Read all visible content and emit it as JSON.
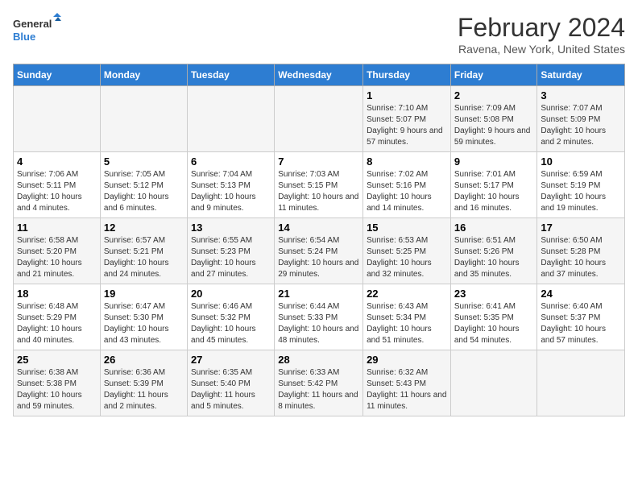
{
  "logo": {
    "line1": "General",
    "line2": "Blue"
  },
  "title": "February 2024",
  "subtitle": "Ravena, New York, United States",
  "days_of_week": [
    "Sunday",
    "Monday",
    "Tuesday",
    "Wednesday",
    "Thursday",
    "Friday",
    "Saturday"
  ],
  "weeks": [
    [
      {
        "day": "",
        "sunrise": "",
        "sunset": "",
        "daylight": ""
      },
      {
        "day": "",
        "sunrise": "",
        "sunset": "",
        "daylight": ""
      },
      {
        "day": "",
        "sunrise": "",
        "sunset": "",
        "daylight": ""
      },
      {
        "day": "",
        "sunrise": "",
        "sunset": "",
        "daylight": ""
      },
      {
        "day": "1",
        "sunrise": "Sunrise: 7:10 AM",
        "sunset": "Sunset: 5:07 PM",
        "daylight": "Daylight: 9 hours and 57 minutes."
      },
      {
        "day": "2",
        "sunrise": "Sunrise: 7:09 AM",
        "sunset": "Sunset: 5:08 PM",
        "daylight": "Daylight: 9 hours and 59 minutes."
      },
      {
        "day": "3",
        "sunrise": "Sunrise: 7:07 AM",
        "sunset": "Sunset: 5:09 PM",
        "daylight": "Daylight: 10 hours and 2 minutes."
      }
    ],
    [
      {
        "day": "4",
        "sunrise": "Sunrise: 7:06 AM",
        "sunset": "Sunset: 5:11 PM",
        "daylight": "Daylight: 10 hours and 4 minutes."
      },
      {
        "day": "5",
        "sunrise": "Sunrise: 7:05 AM",
        "sunset": "Sunset: 5:12 PM",
        "daylight": "Daylight: 10 hours and 6 minutes."
      },
      {
        "day": "6",
        "sunrise": "Sunrise: 7:04 AM",
        "sunset": "Sunset: 5:13 PM",
        "daylight": "Daylight: 10 hours and 9 minutes."
      },
      {
        "day": "7",
        "sunrise": "Sunrise: 7:03 AM",
        "sunset": "Sunset: 5:15 PM",
        "daylight": "Daylight: 10 hours and 11 minutes."
      },
      {
        "day": "8",
        "sunrise": "Sunrise: 7:02 AM",
        "sunset": "Sunset: 5:16 PM",
        "daylight": "Daylight: 10 hours and 14 minutes."
      },
      {
        "day": "9",
        "sunrise": "Sunrise: 7:01 AM",
        "sunset": "Sunset: 5:17 PM",
        "daylight": "Daylight: 10 hours and 16 minutes."
      },
      {
        "day": "10",
        "sunrise": "Sunrise: 6:59 AM",
        "sunset": "Sunset: 5:19 PM",
        "daylight": "Daylight: 10 hours and 19 minutes."
      }
    ],
    [
      {
        "day": "11",
        "sunrise": "Sunrise: 6:58 AM",
        "sunset": "Sunset: 5:20 PM",
        "daylight": "Daylight: 10 hours and 21 minutes."
      },
      {
        "day": "12",
        "sunrise": "Sunrise: 6:57 AM",
        "sunset": "Sunset: 5:21 PM",
        "daylight": "Daylight: 10 hours and 24 minutes."
      },
      {
        "day": "13",
        "sunrise": "Sunrise: 6:55 AM",
        "sunset": "Sunset: 5:23 PM",
        "daylight": "Daylight: 10 hours and 27 minutes."
      },
      {
        "day": "14",
        "sunrise": "Sunrise: 6:54 AM",
        "sunset": "Sunset: 5:24 PM",
        "daylight": "Daylight: 10 hours and 29 minutes."
      },
      {
        "day": "15",
        "sunrise": "Sunrise: 6:53 AM",
        "sunset": "Sunset: 5:25 PM",
        "daylight": "Daylight: 10 hours and 32 minutes."
      },
      {
        "day": "16",
        "sunrise": "Sunrise: 6:51 AM",
        "sunset": "Sunset: 5:26 PM",
        "daylight": "Daylight: 10 hours and 35 minutes."
      },
      {
        "day": "17",
        "sunrise": "Sunrise: 6:50 AM",
        "sunset": "Sunset: 5:28 PM",
        "daylight": "Daylight: 10 hours and 37 minutes."
      }
    ],
    [
      {
        "day": "18",
        "sunrise": "Sunrise: 6:48 AM",
        "sunset": "Sunset: 5:29 PM",
        "daylight": "Daylight: 10 hours and 40 minutes."
      },
      {
        "day": "19",
        "sunrise": "Sunrise: 6:47 AM",
        "sunset": "Sunset: 5:30 PM",
        "daylight": "Daylight: 10 hours and 43 minutes."
      },
      {
        "day": "20",
        "sunrise": "Sunrise: 6:46 AM",
        "sunset": "Sunset: 5:32 PM",
        "daylight": "Daylight: 10 hours and 45 minutes."
      },
      {
        "day": "21",
        "sunrise": "Sunrise: 6:44 AM",
        "sunset": "Sunset: 5:33 PM",
        "daylight": "Daylight: 10 hours and 48 minutes."
      },
      {
        "day": "22",
        "sunrise": "Sunrise: 6:43 AM",
        "sunset": "Sunset: 5:34 PM",
        "daylight": "Daylight: 10 hours and 51 minutes."
      },
      {
        "day": "23",
        "sunrise": "Sunrise: 6:41 AM",
        "sunset": "Sunset: 5:35 PM",
        "daylight": "Daylight: 10 hours and 54 minutes."
      },
      {
        "day": "24",
        "sunrise": "Sunrise: 6:40 AM",
        "sunset": "Sunset: 5:37 PM",
        "daylight": "Daylight: 10 hours and 57 minutes."
      }
    ],
    [
      {
        "day": "25",
        "sunrise": "Sunrise: 6:38 AM",
        "sunset": "Sunset: 5:38 PM",
        "daylight": "Daylight: 10 hours and 59 minutes."
      },
      {
        "day": "26",
        "sunrise": "Sunrise: 6:36 AM",
        "sunset": "Sunset: 5:39 PM",
        "daylight": "Daylight: 11 hours and 2 minutes."
      },
      {
        "day": "27",
        "sunrise": "Sunrise: 6:35 AM",
        "sunset": "Sunset: 5:40 PM",
        "daylight": "Daylight: 11 hours and 5 minutes."
      },
      {
        "day": "28",
        "sunrise": "Sunrise: 6:33 AM",
        "sunset": "Sunset: 5:42 PM",
        "daylight": "Daylight: 11 hours and 8 minutes."
      },
      {
        "day": "29",
        "sunrise": "Sunrise: 6:32 AM",
        "sunset": "Sunset: 5:43 PM",
        "daylight": "Daylight: 11 hours and 11 minutes."
      },
      {
        "day": "",
        "sunrise": "",
        "sunset": "",
        "daylight": ""
      },
      {
        "day": "",
        "sunrise": "",
        "sunset": "",
        "daylight": ""
      }
    ]
  ]
}
